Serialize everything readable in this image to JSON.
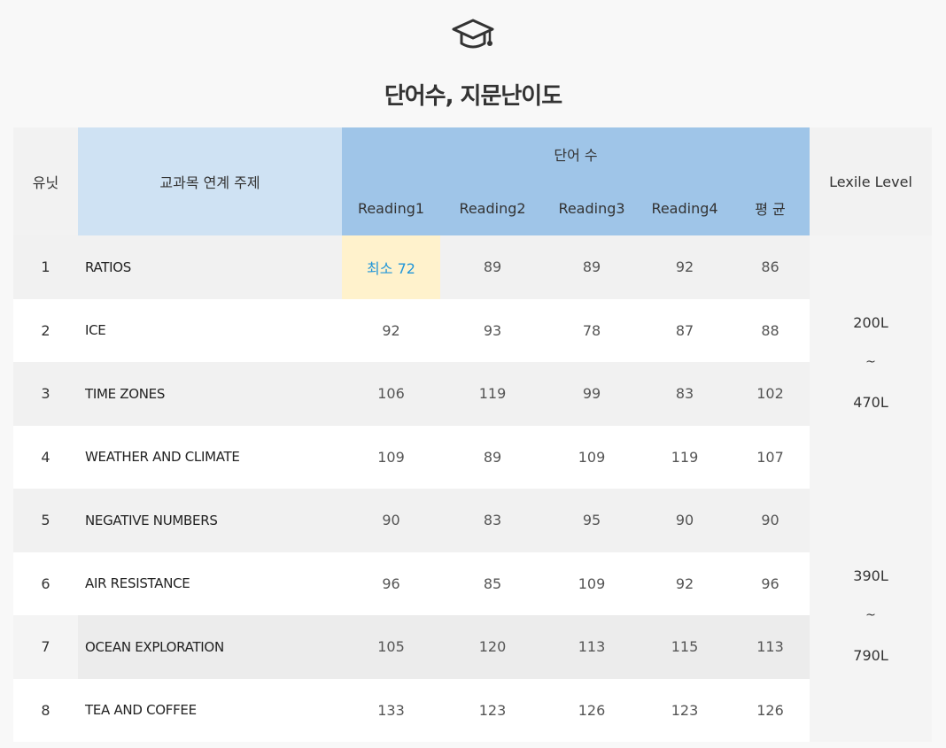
{
  "header": {
    "icon": "graduation-cap-icon",
    "title": "단어수, 지문난이도"
  },
  "table": {
    "col_unit": "유닛",
    "col_topic": "교과목 연계 주제",
    "col_words": "단어 수",
    "col_readings": [
      "Reading1",
      "Reading2",
      "Reading3",
      "Reading4",
      "평 균"
    ],
    "col_lexile": "Lexile Level",
    "rows": [
      {
        "unit": "1",
        "topic": "RATIOS",
        "r1": "최소 72",
        "r2": "89",
        "r3": "89",
        "r4": "92",
        "avg": "86"
      },
      {
        "unit": "2",
        "topic": "ICE",
        "r1": "92",
        "r2": "93",
        "r3": "78",
        "r4": "87",
        "avg": "88"
      },
      {
        "unit": "3",
        "topic": "TIME ZONES",
        "r1": "106",
        "r2": "119",
        "r3": "99",
        "r4": "83",
        "avg": "102"
      },
      {
        "unit": "4",
        "topic": "WEATHER AND CLIMATE",
        "r1": "109",
        "r2": "89",
        "r3": "109",
        "r4": "119",
        "avg": "107"
      },
      {
        "unit": "5",
        "topic": "NEGATIVE NUMBERS",
        "r1": "90",
        "r2": "83",
        "r3": "95",
        "r4": "90",
        "avg": "90"
      },
      {
        "unit": "6",
        "topic": "AIR RESISTANCE",
        "r1": "96",
        "r2": "85",
        "r3": "109",
        "r4": "92",
        "avg": "96"
      },
      {
        "unit": "7",
        "topic": "OCEAN EXPLORATION",
        "r1": "105",
        "r2": "120",
        "r3": "113",
        "r4": "115",
        "avg": "113"
      },
      {
        "unit": "8",
        "topic": "TEA AND COFFEE",
        "r1": "133",
        "r2": "123",
        "r3": "126",
        "r4": "123",
        "avg": "126"
      }
    ],
    "lexile_groups": [
      {
        "low": "200L",
        "sep": "~",
        "high": "470L"
      },
      {
        "low": "390L",
        "sep": "~",
        "high": "790L"
      }
    ]
  },
  "colors": {
    "header_light_blue": "#cfe2f3",
    "header_blue": "#9fc5e8",
    "highlight_yellow": "#fff2cc",
    "highlight_text": "#2196d8"
  }
}
